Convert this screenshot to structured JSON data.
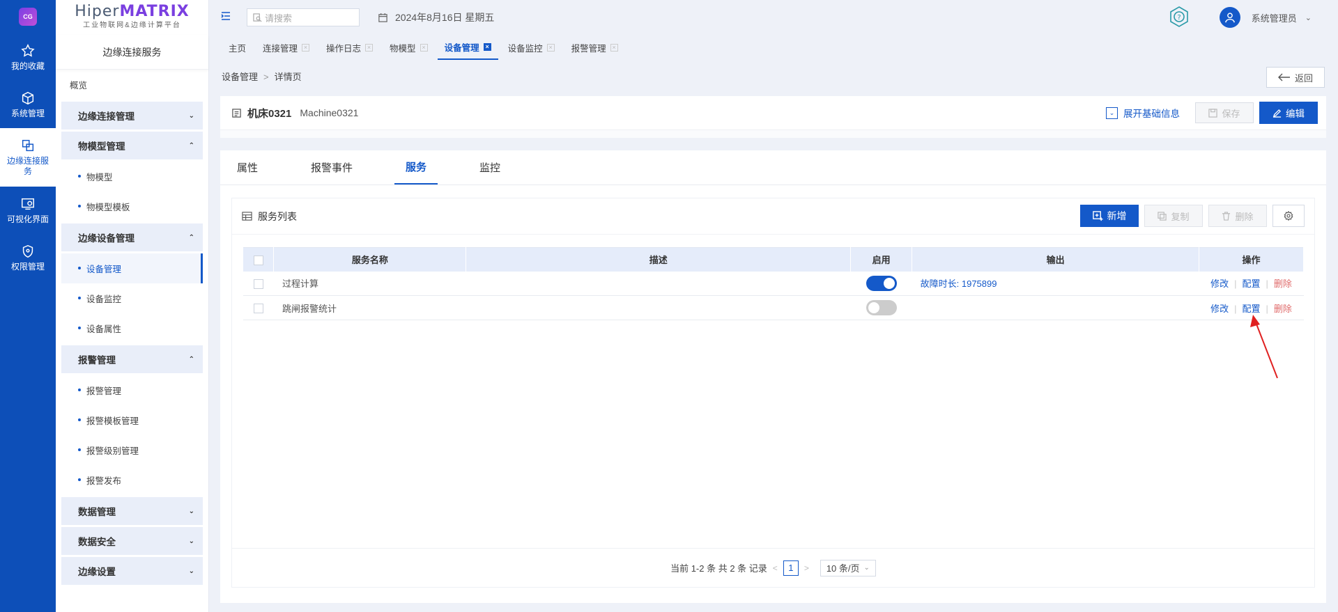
{
  "rail": {
    "items": [
      {
        "label": "我的收藏",
        "icon": "star-icon"
      },
      {
        "label": "系统管理",
        "icon": "cube-icon"
      },
      {
        "label": "边缘连接服务",
        "icon": "edge-connect-icon"
      },
      {
        "label": "可视化界面",
        "icon": "visual-screen-icon"
      },
      {
        "label": "权限管理",
        "icon": "shield-icon"
      }
    ]
  },
  "brand": {
    "prefix": "Hiper",
    "highlight": "MATRIX",
    "subtitle": "工业物联网&边缘计算平台"
  },
  "sidebar": {
    "title": "边缘连接服务",
    "overview": "概览",
    "groups": [
      {
        "label": "边缘连接管理",
        "items": []
      },
      {
        "label": "物模型管理",
        "items": [
          "物模型",
          "物模型模板"
        ]
      },
      {
        "label": "边缘设备管理",
        "items": [
          "设备管理",
          "设备监控",
          "设备属性"
        ]
      },
      {
        "label": "报警管理",
        "items": [
          "报警管理",
          "报警模板管理",
          "报警级别管理",
          "报警发布"
        ]
      },
      {
        "label": "数据管理",
        "items": []
      },
      {
        "label": "数据安全",
        "items": []
      },
      {
        "label": "边缘设置",
        "items": []
      }
    ]
  },
  "topbar": {
    "search_placeholder": "请搜索",
    "date": "2024年8月16日 星期五",
    "username": "系统管理员"
  },
  "tabs": [
    "主页",
    "连接管理",
    "操作日志",
    "物模型",
    "设备管理",
    "设备监控",
    "报警管理"
  ],
  "breadcrumb": {
    "parent": "设备管理",
    "separator": ">",
    "current": "详情页"
  },
  "back_label": "返回",
  "header": {
    "title": "机床0321",
    "subtitle": "Machine0321",
    "expand_label": "展开基础信息",
    "save_label": "保存",
    "edit_label": "编辑"
  },
  "subtabs": [
    "属性",
    "报警事件",
    "服务",
    "监控"
  ],
  "panel": {
    "title": "服务列表",
    "new_label": "新增",
    "copy_label": "复制",
    "delete_label": "删除"
  },
  "table": {
    "columns": [
      "服务名称",
      "描述",
      "启用",
      "输出",
      "操作"
    ],
    "rows": [
      {
        "name": "过程计算",
        "desc": "",
        "enabled": true,
        "output": "故障时长: 1975899"
      },
      {
        "name": "跳闸报警统计",
        "desc": "",
        "enabled": false,
        "output": ""
      }
    ],
    "ops": {
      "edit": "修改",
      "config": "配置",
      "delete": "删除",
      "sep": "|"
    }
  },
  "pager": {
    "summary": "当前 1-2 条 共 2 条 记录",
    "page": "1",
    "size": "10 条/页"
  },
  "colors": {
    "primary": "#1459c9",
    "danger": "#e06b6b",
    "annotation": "#e02020"
  }
}
